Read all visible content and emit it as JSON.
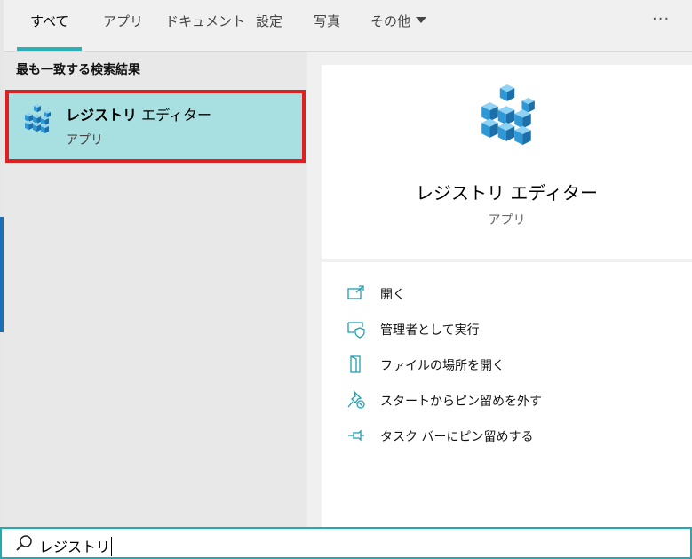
{
  "tabs": [
    {
      "label": "すべて",
      "active": true
    },
    {
      "label": "アプリ",
      "active": false
    },
    {
      "label": "ドキュメント",
      "active": false
    },
    {
      "label": "設定",
      "active": false
    },
    {
      "label": "写真",
      "active": false
    },
    {
      "label": "その他",
      "active": false
    }
  ],
  "more_label": "···",
  "results": {
    "section_title": "最も一致する検索結果",
    "best_match": {
      "name_bold": "レジストリ",
      "name_rest": " エディター",
      "type": "アプリ",
      "icon": "registry-editor-icon"
    }
  },
  "detail": {
    "title": "レジストリ エディター",
    "subtitle": "アプリ",
    "icon": "registry-editor-icon",
    "actions": [
      {
        "label": "開く",
        "icon": "open-icon"
      },
      {
        "label": "管理者として実行",
        "icon": "run-as-admin-icon"
      },
      {
        "label": "ファイルの場所を開く",
        "icon": "file-location-icon"
      },
      {
        "label": "スタートからピン留めを外す",
        "icon": "unpin-start-icon"
      },
      {
        "label": "タスク バーにピン留めする",
        "icon": "pin-taskbar-icon"
      }
    ]
  },
  "search": {
    "query": "レジストリ",
    "icon": "search-icon"
  },
  "colors": {
    "accent": "#2bb0b4",
    "selection": "#a8dfe0",
    "highlight_border": "#e02020",
    "cube_blue": "#2f98d6"
  }
}
